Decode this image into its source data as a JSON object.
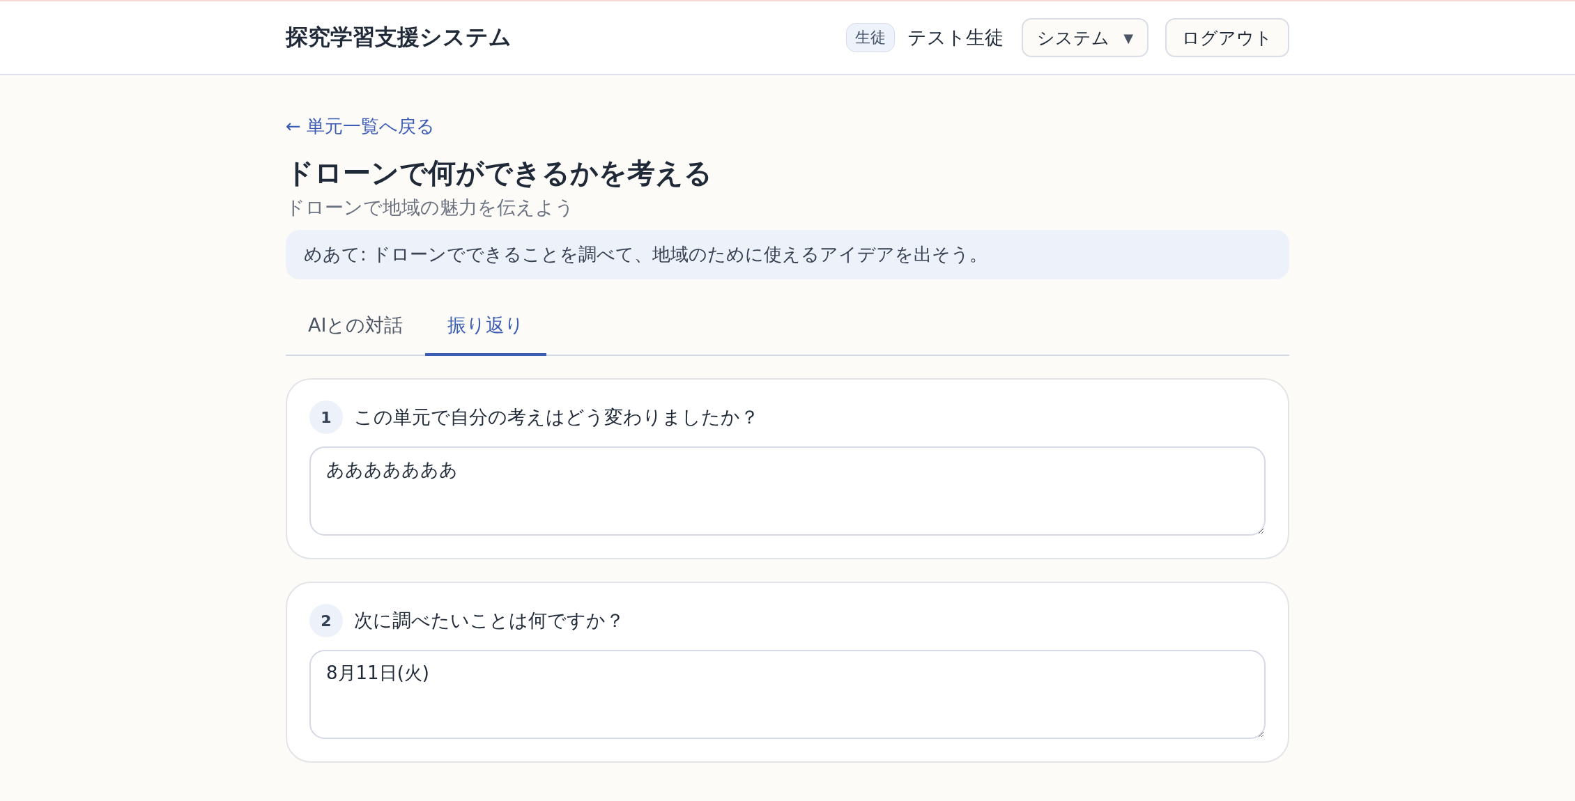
{
  "header": {
    "title": "探究学習支援システム",
    "role_badge": "生徒",
    "user_name": "テスト生徒",
    "mode_select": {
      "value": "システム",
      "caret": "▼"
    },
    "logout_button": "ログアウト"
  },
  "back_link": {
    "arrow": "←",
    "label": "単元一覧へ戻る"
  },
  "page_title": "ドローンで何ができるかを考える",
  "unit_subtitle": "ドローンで地域の魅力を伝えよう",
  "goal": "めあて: ドローンでできることを調べて、地域のために使えるアイデアを出そう。",
  "tabs": [
    {
      "label": "AIとの対話",
      "selected": false
    },
    {
      "label": "振り返り",
      "selected": true
    }
  ],
  "questions": [
    {
      "number": "1",
      "text": "この単元で自分の考えはどう変わりましたか？",
      "answer": "あああああああ"
    },
    {
      "number": "2",
      "text": "次に調べたいことは何ですか？",
      "answer": "8月11日(火)"
    }
  ]
}
